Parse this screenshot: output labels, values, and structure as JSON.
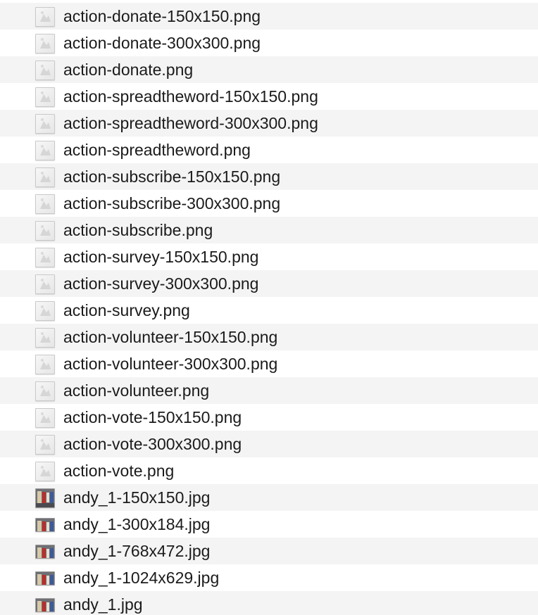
{
  "files": [
    {
      "name": "action-donate-150x150.png",
      "icon": "image-thumbnail-icon"
    },
    {
      "name": "action-donate-300x300.png",
      "icon": "image-thumbnail-icon"
    },
    {
      "name": "action-donate.png",
      "icon": "image-thumbnail-icon"
    },
    {
      "name": "action-spreadtheword-150x150.png",
      "icon": "image-thumbnail-icon"
    },
    {
      "name": "action-spreadtheword-300x300.png",
      "icon": "image-thumbnail-icon"
    },
    {
      "name": "action-spreadtheword.png",
      "icon": "image-thumbnail-icon"
    },
    {
      "name": "action-subscribe-150x150.png",
      "icon": "image-thumbnail-icon"
    },
    {
      "name": "action-subscribe-300x300.png",
      "icon": "image-thumbnail-icon"
    },
    {
      "name": "action-subscribe.png",
      "icon": "image-thumbnail-icon"
    },
    {
      "name": "action-survey-150x150.png",
      "icon": "image-thumbnail-icon"
    },
    {
      "name": "action-survey-300x300.png",
      "icon": "image-thumbnail-icon"
    },
    {
      "name": "action-survey.png",
      "icon": "image-thumbnail-icon"
    },
    {
      "name": "action-volunteer-150x150.png",
      "icon": "image-thumbnail-icon"
    },
    {
      "name": "action-volunteer-300x300.png",
      "icon": "image-thumbnail-icon"
    },
    {
      "name": "action-volunteer.png",
      "icon": "image-thumbnail-icon"
    },
    {
      "name": "action-vote-150x150.png",
      "icon": "image-thumbnail-icon"
    },
    {
      "name": "action-vote-300x300.png",
      "icon": "image-thumbnail-icon"
    },
    {
      "name": "action-vote.png",
      "icon": "image-thumbnail-icon"
    },
    {
      "name": "andy_1-150x150.jpg",
      "icon": "photo-thumbnail-icon"
    },
    {
      "name": "andy_1-300x184.jpg",
      "icon": "photo-thumbnail-icon"
    },
    {
      "name": "andy_1-768x472.jpg",
      "icon": "photo-thumbnail-icon"
    },
    {
      "name": "andy_1-1024x629.jpg",
      "icon": "photo-thumbnail-icon"
    },
    {
      "name": "andy_1.jpg",
      "icon": "photo-thumbnail-icon"
    }
  ]
}
